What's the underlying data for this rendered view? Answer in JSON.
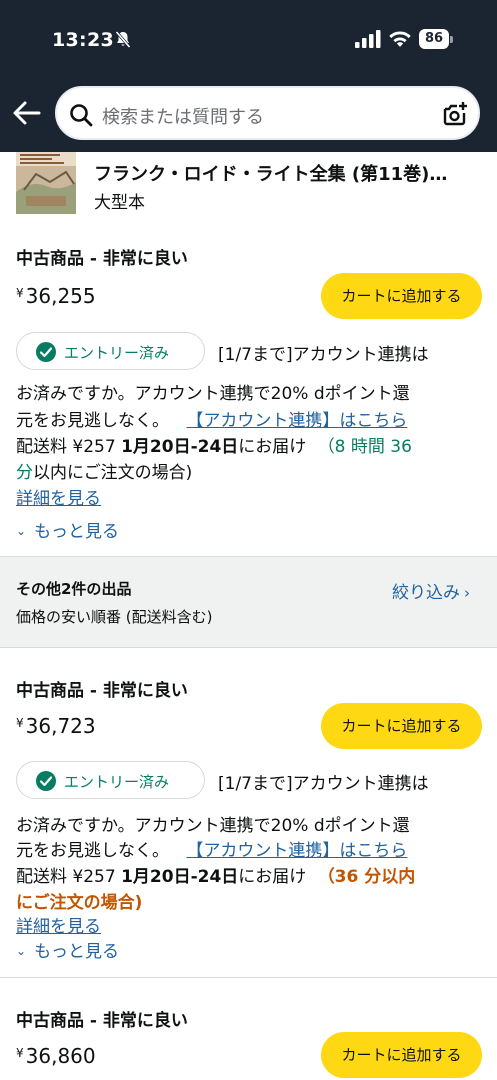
{
  "status_bar": {
    "time": "13:23",
    "battery": "86"
  },
  "search": {
    "placeholder": "検索または質問する"
  },
  "product": {
    "title": "フランク・ロイド・ライト全集 (第11巻)…",
    "format": "大型本"
  },
  "offers": [
    {
      "condition": "中古商品 - 非常に良い",
      "currency": "¥",
      "price": "36,255",
      "cart_label": "カートに追加する",
      "entry_label": "エントリー済み",
      "promo_1": "[1/7まで]アカウント連携は",
      "promo_2": "お済みですか。アカウント連携で20% dポイント還",
      "promo_3_a": "元をお見逃しなく。 ",
      "promo_3_link": "【アカウント連携】はこちら",
      "ship_prefix": "配送料 ¥257 ",
      "ship_date": "1月20日-24日",
      "ship_suffix": "にお届け ",
      "ship_deadline_1": "（8 時間 36",
      "ship_deadline_2": "分",
      "ship_deadline_tail": "以内にご注文の場合)",
      "details_link": "詳細を見る",
      "more_label": "もっと見る"
    },
    {
      "condition": "中古商品 - 非常に良い",
      "currency": "¥",
      "price": "36,723",
      "cart_label": "カートに追加する",
      "entry_label": "エントリー済み",
      "promo_1": "[1/7まで]アカウント連携は",
      "promo_2": "お済みですか。アカウント連携で20% dポイント還",
      "promo_3_a": "元をお見逃しなく。 ",
      "promo_3_link": "【アカウント連携】はこちら",
      "ship_prefix": "配送料 ¥257 ",
      "ship_date": "1月20日-24日",
      "ship_suffix": "にお届け ",
      "ship_deadline_1": "（36 分以内",
      "ship_deadline_2": "にご注文の場合)",
      "details_link": "詳細を見る",
      "more_label": "もっと見る"
    },
    {
      "condition": "中古商品 - 非常に良い",
      "currency": "¥",
      "price": "36,860",
      "cart_label": "カートに追加する"
    }
  ],
  "other_sellers": {
    "title": "その他2件の出品",
    "sort": "価格の安い順番 (配送料含む)",
    "filter": "絞り込み"
  },
  "colors": {
    "header_bg": "#1b2431",
    "cart_button": "#ffd814",
    "link": "#2162a1",
    "entry_green": "#067d62",
    "urgent_orange": "#c45500"
  }
}
